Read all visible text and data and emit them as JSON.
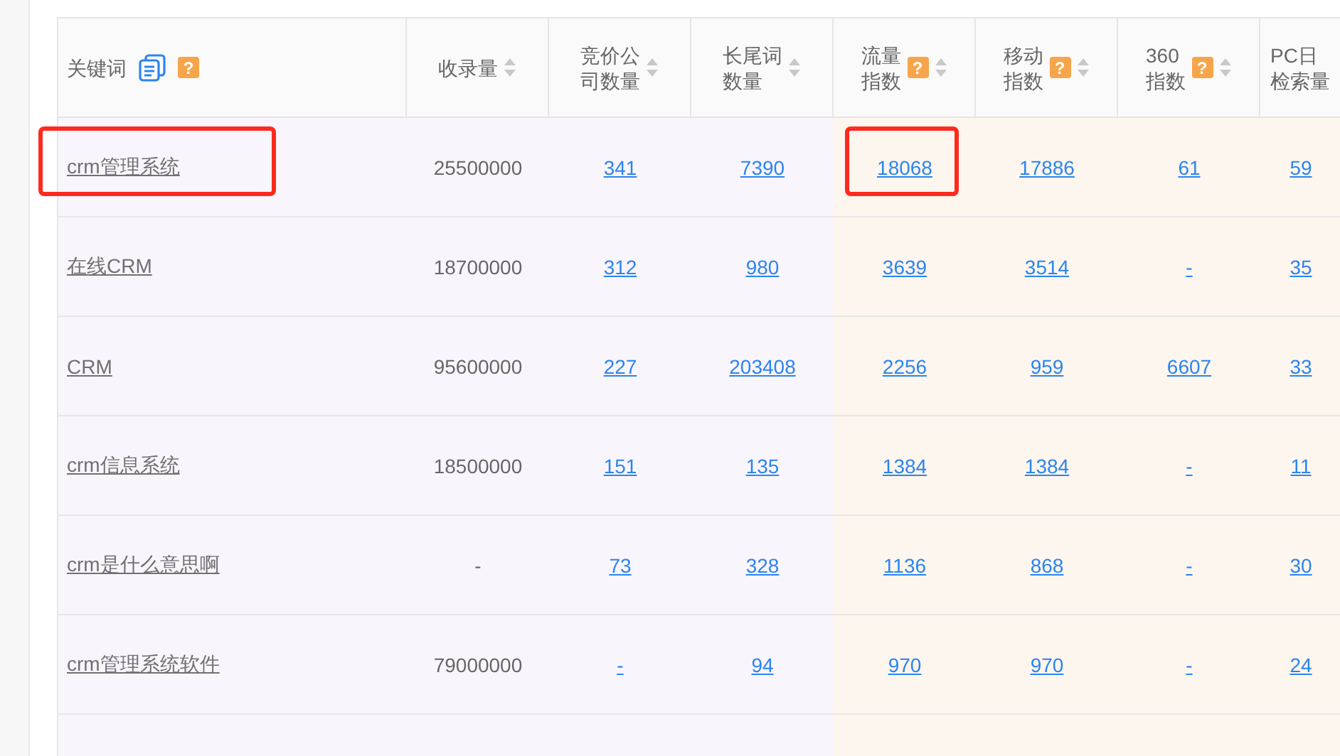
{
  "table": {
    "columns": [
      {
        "kind": "keyword",
        "lines": [
          "关键词"
        ],
        "icons": [
          {
            "kind": "copy"
          },
          {
            "kind": "help",
            "glyph": "?"
          }
        ]
      },
      {
        "kind": "plain",
        "lines": [
          "收录量"
        ],
        "icons": [
          {
            "kind": "sort"
          }
        ]
      },
      {
        "kind": "link",
        "lines": [
          "竞价公",
          "司数量"
        ],
        "icons": [
          {
            "kind": "sort"
          }
        ]
      },
      {
        "kind": "link",
        "lines": [
          "长尾词",
          "数量"
        ],
        "icons": [
          {
            "kind": "sort"
          }
        ]
      },
      {
        "kind": "link",
        "lines": [
          "流量",
          "指数"
        ],
        "icons": [
          {
            "kind": "help",
            "glyph": "?"
          },
          {
            "kind": "sort"
          }
        ]
      },
      {
        "kind": "link",
        "lines": [
          "移动",
          "指数"
        ],
        "icons": [
          {
            "kind": "help",
            "glyph": "?"
          },
          {
            "kind": "sort"
          }
        ]
      },
      {
        "kind": "link",
        "lines": [
          "360",
          "指数"
        ],
        "icons": [
          {
            "kind": "help",
            "glyph": "?"
          },
          {
            "kind": "sort"
          }
        ]
      },
      {
        "kind": "link",
        "lines": [
          "PC日",
          "检索量"
        ]
      }
    ],
    "rows": [
      {
        "cells": [
          "crm管理系统",
          "25500000",
          "341",
          "7390",
          "18068",
          "17886",
          "61",
          "59"
        ],
        "marked": [
          true,
          false,
          false,
          false,
          true,
          false,
          false,
          false
        ]
      },
      {
        "cells": [
          "在线CRM",
          "18700000",
          "312",
          "980",
          "3639",
          "3514",
          "-",
          "35"
        ],
        "marked": [
          false,
          false,
          false,
          false,
          false,
          false,
          false,
          false
        ]
      },
      {
        "cells": [
          "CRM",
          "95600000",
          "227",
          "203408",
          "2256",
          "959",
          "6607",
          "33"
        ],
        "marked": [
          false,
          false,
          false,
          false,
          false,
          false,
          false,
          false
        ]
      },
      {
        "cells": [
          "crm信息系统",
          "18500000",
          "151",
          "135",
          "1384",
          "1384",
          "-",
          "11"
        ],
        "marked": [
          false,
          false,
          false,
          false,
          false,
          false,
          false,
          false
        ]
      },
      {
        "cells": [
          "crm是什么意思啊",
          "-",
          "73",
          "328",
          "1136",
          "868",
          "-",
          "30"
        ],
        "marked": [
          false,
          false,
          false,
          false,
          false,
          false,
          false,
          false
        ]
      },
      {
        "cells": [
          "crm管理系统软件",
          "79000000",
          "-",
          "94",
          "970",
          "970",
          "-",
          "24"
        ],
        "marked": [
          false,
          false,
          false,
          false,
          false,
          false,
          false,
          false
        ]
      }
    ]
  }
}
